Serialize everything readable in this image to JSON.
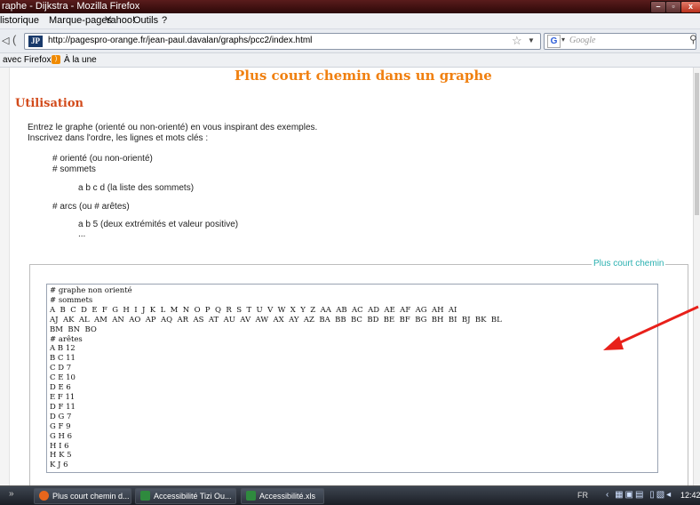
{
  "window": {
    "title": "raphe - Dijkstra - Mozilla Firefox",
    "controls": [
      "–",
      "▫",
      "x"
    ]
  },
  "menu": [
    "listorique",
    "Marque-pages",
    "Yahoo!",
    "Outils",
    "?"
  ],
  "nav": {
    "url": "http://pagespro-orange.fr/jean-paul.davalan/graphs/pcc2/index.html",
    "favicon_text": "JP",
    "search_placeholder": "Google"
  },
  "bookmarks": [
    "avec Firefox",
    "À la une"
  ],
  "page": {
    "title": "Plus court chemin dans un graphe",
    "section": "Utilisation",
    "intro1": "Entrez le graphe (orienté ou non-orienté) en vous inspirant des exemples.",
    "intro2": "Inscrivez dans l'ordre, les lignes et mots clés :",
    "kw1": "# orienté (ou non-orienté)",
    "kw2": "# sommets",
    "kw2_desc": "a b c d (la liste des sommets)",
    "kw3": "# arcs (ou # arêtes)",
    "kw3_desc": "a b 5 (deux extrémités et valeur positive)",
    "ellipsis": "...",
    "fieldset_legend": "Plus court chemin",
    "textarea_lines": [
      "# graphe non orienté",
      "# sommets",
      "A  B  C  D  E  F  G  H  I  J  K  L  M  N  O  P  Q  R  S  T  U  V  W  X  Y  Z  AA  AB  AC  AD  AE  AF  AG  AH  AI",
      "AJ  AK  AL  AM  AN  AO  AP  AQ  AR  AS  AT  AU  AV  AW  AX  AY  AZ  BA  BB  BC  BD  BE  BF  BG  BH  BI  BJ  BK  BL",
      "BM  BN  BO",
      "# arêtes",
      "A B 12",
      "B C 11",
      "C D 7",
      "C E 10",
      "D E 6",
      "E F 11",
      "D F 11",
      "D G 7",
      "G F 9",
      "G H 6",
      "H I 6",
      "H K 5",
      "K J 6"
    ]
  },
  "taskbar": {
    "items": [
      "Plus court chemin d...",
      "Accessibilité Tizi Ou...",
      "Accessibilité.xls"
    ],
    "lang": "FR",
    "clock": "12:42"
  },
  "colors": {
    "title_orange": "#f08010",
    "section_red": "#d24a1a",
    "legend_teal": "#2ab0b0",
    "arrow_red": "#e8201a"
  }
}
